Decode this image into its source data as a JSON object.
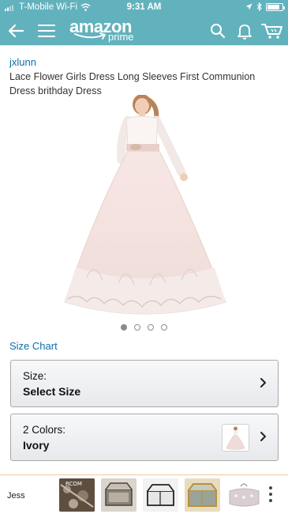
{
  "status_bar": {
    "carrier": "T-Mobile Wi-Fi",
    "time": "9:31 AM",
    "battery_level": 0.85
  },
  "nav": {
    "logo_word": "amazon",
    "logo_sub": "prime",
    "icons": [
      "back-arrow-icon",
      "hamburger-menu-icon",
      "search-icon",
      "bell-icon",
      "cart-icon"
    ]
  },
  "product": {
    "brand": "jxlunn",
    "title": "Lace Flower Girls Dress Long Sleeves First Communion Dress brithday Dress",
    "image_count": 4,
    "active_image": 0
  },
  "size_chart_link": "Size Chart",
  "size_selector": {
    "label": "Size:",
    "value": "Select Size"
  },
  "color_selector": {
    "label": "2 Colors:",
    "value": "Ivory"
  },
  "bottom_bar": {
    "user": "Jess",
    "thumbnails": [
      "thumb-1",
      "thumb-2",
      "thumb-3",
      "thumb-4",
      "thumb-5"
    ],
    "thumbnail_caption": "RCOM"
  },
  "colors": {
    "header": "#62b2bd",
    "link": "#0f6fa8"
  }
}
